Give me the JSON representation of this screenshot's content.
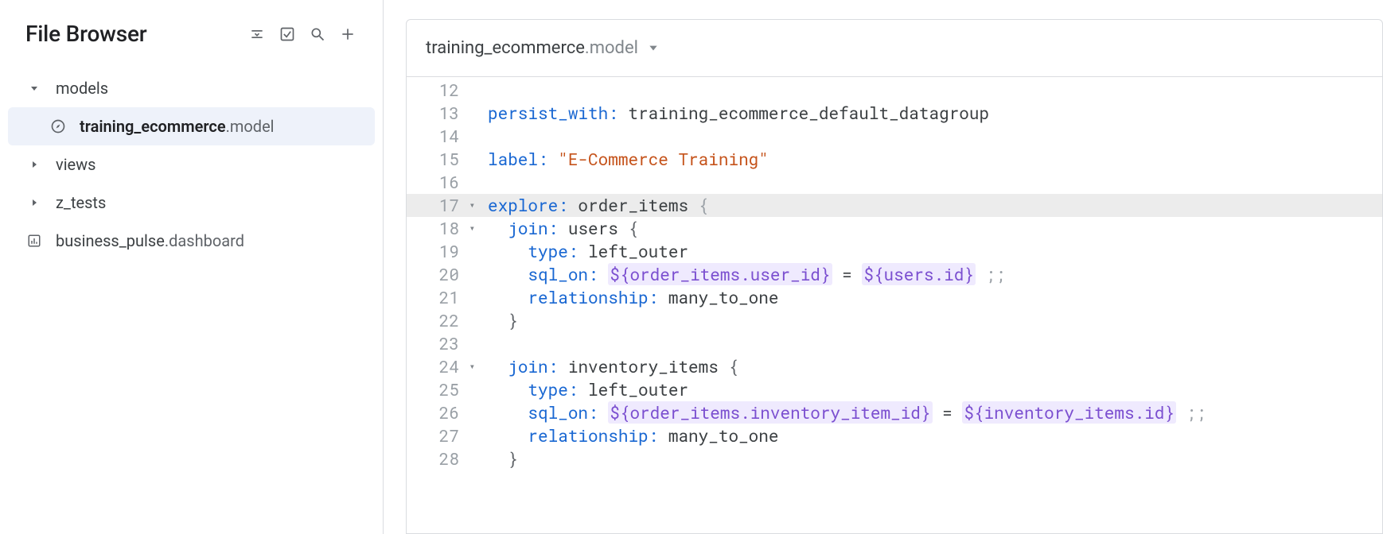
{
  "sidebar": {
    "title": "File Browser",
    "actions": {
      "collapse": "collapse-icon",
      "validate": "validate-icon",
      "search": "search-icon",
      "add": "add-icon"
    },
    "tree": {
      "models_label": "models",
      "file_training_name": "training_ecommerce",
      "file_training_ext": ".model",
      "views_label": "views",
      "ztests_label": "z_tests",
      "business_pulse_name": "business_pulse",
      "business_pulse_ext": ".dashboard"
    }
  },
  "tab": {
    "name": "training_ecommerce",
    "ext": ".model"
  },
  "lines": {
    "l12": "12",
    "l13": "13",
    "l14": "14",
    "l15": "15",
    "l16": "16",
    "l17": "17",
    "l18": "18",
    "l19": "19",
    "l20": "20",
    "l21": "21",
    "l22": "22",
    "l23": "23",
    "l24": "24",
    "l25": "25",
    "l26": "26",
    "l27": "27",
    "l28": "28"
  },
  "code": {
    "persist_with_key": "persist_with:",
    "persist_with_val": " training_ecommerce_default_datagroup",
    "label_key": "label:",
    "label_val": " \"E-Commerce Training\"",
    "explore_key": "explore:",
    "explore_val": " order_items ",
    "explore_brace": "{",
    "join1_key": "join:",
    "join1_val": " users ",
    "brace_open": "{",
    "type_key": "type:",
    "type_val": " left_outer",
    "sqlon_key": "sql_on:",
    "sqlon1_interp_a": "${order_items.user_id}",
    "sqlon_eq": " = ",
    "sqlon1_interp_b": "${users.id}",
    "sqlon_tail": " ;;",
    "rel_key": "relationship:",
    "rel_val": " many_to_one",
    "brace_close": "}",
    "join2_key": "join:",
    "join2_val": " inventory_items ",
    "sqlon2_interp_a": "${order_items.inventory_item_id}",
    "sqlon2_interp_b": "${inventory_items.id}"
  }
}
